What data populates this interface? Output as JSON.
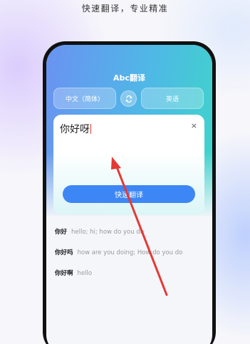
{
  "tagline": "快速翻译，专业精准",
  "app": {
    "title": "Abc翻译"
  },
  "languages": {
    "source": "中文（简体）",
    "target": "英语"
  },
  "input": {
    "value": "你好呀",
    "clear": "×"
  },
  "translate_button": "快速翻译",
  "suggestions": [
    {
      "word": "你好",
      "definition": "hello; hi; how do you do"
    },
    {
      "word": "你好吗",
      "definition": "how are you doing; How do you do"
    },
    {
      "word": "你好啊",
      "definition": "hello"
    }
  ],
  "colors": {
    "primary": "#3d86f5",
    "annotation_arrow": "#e53935"
  },
  "icons": {
    "swap": "swap-icon"
  }
}
